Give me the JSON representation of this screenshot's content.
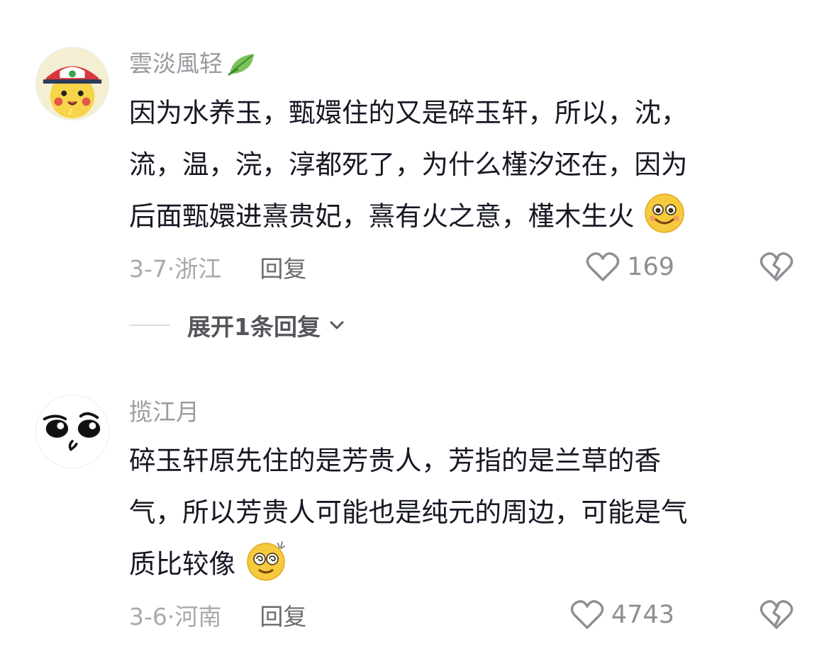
{
  "comments": [
    {
      "username": "雲淡風轻",
      "username_icon": "leaf-icon",
      "lines": [
        "因为水养玉，甄嬛住的又是碎玉轩，所以，沈，",
        "流，温，浣，淳都死了，为什么槿汐还在，因为",
        "后面甄嬛进熹贵妃，熹有火之意，槿木生火"
      ],
      "trailing_emoji": "smile-emoji",
      "date": "3-7·浙江",
      "reply_label": "回复",
      "likes": "169",
      "expand_label": "展开1条回复"
    },
    {
      "username": "揽江月",
      "lines": [
        "碎玉轩原先住的是芳贵人，芳指的是兰草的香",
        "气，所以芳贵人可能也是纯元的周边，可能是气",
        "质比较像"
      ],
      "trailing_emoji": "dizzy-emoji",
      "date": "3-6·河南",
      "reply_label": "回复",
      "likes": "4743"
    }
  ],
  "colors": {
    "text": "#161823",
    "username": "#9a9aa0",
    "meta": "#a8a8ae",
    "icon": "#8e8e94"
  }
}
